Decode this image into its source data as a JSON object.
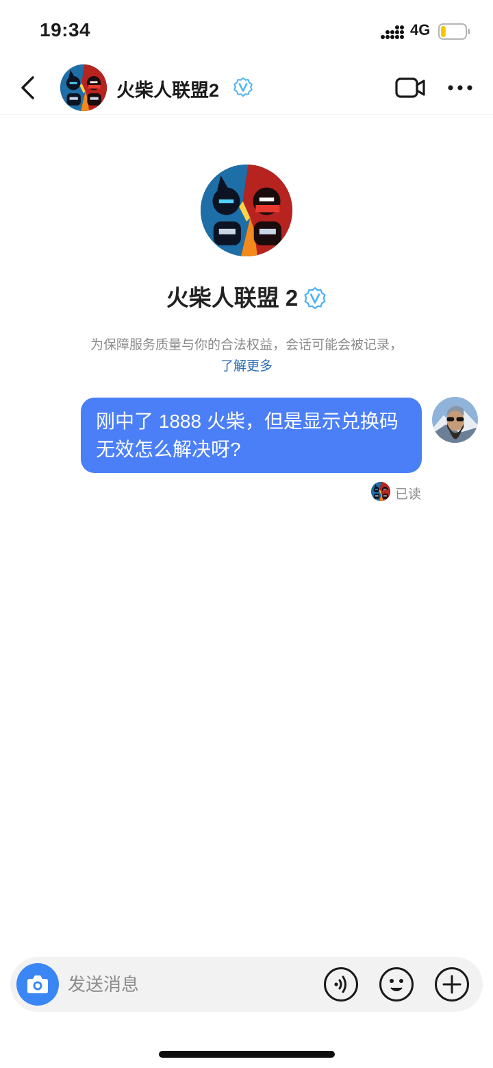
{
  "status_bar": {
    "time": "19:34",
    "network": "4G",
    "battery_level": 0.2,
    "icons": [
      "signal-icon",
      "battery-icon"
    ]
  },
  "header": {
    "back_icon": "chevron-left-icon",
    "title": "火柴人联盟2",
    "verified_icon": "verified-v-icon",
    "video_icon": "video-camera-icon",
    "more_icon": "more-dots-icon"
  },
  "profile": {
    "name": "火柴人联盟 2",
    "notice_text": "为保障服务质量与你的合法权益，会话可能会被记录，",
    "notice_link": "了解更多"
  },
  "messages": [
    {
      "sender": "me",
      "text": "刚中了 1888 火柴，但是显示兑换码无效怎么解决呀?",
      "status": "已读"
    }
  ],
  "input_bar": {
    "placeholder": "发送消息",
    "icons": [
      "camera-icon",
      "voice-icon",
      "emoji-icon",
      "plus-icon"
    ]
  },
  "colors": {
    "bubble": "#4b7ff7",
    "link": "#2b6cb0",
    "camera_button": "#3a86f5",
    "verified_badge": "#4fb3f0",
    "battery_fill": "#f7c600"
  }
}
